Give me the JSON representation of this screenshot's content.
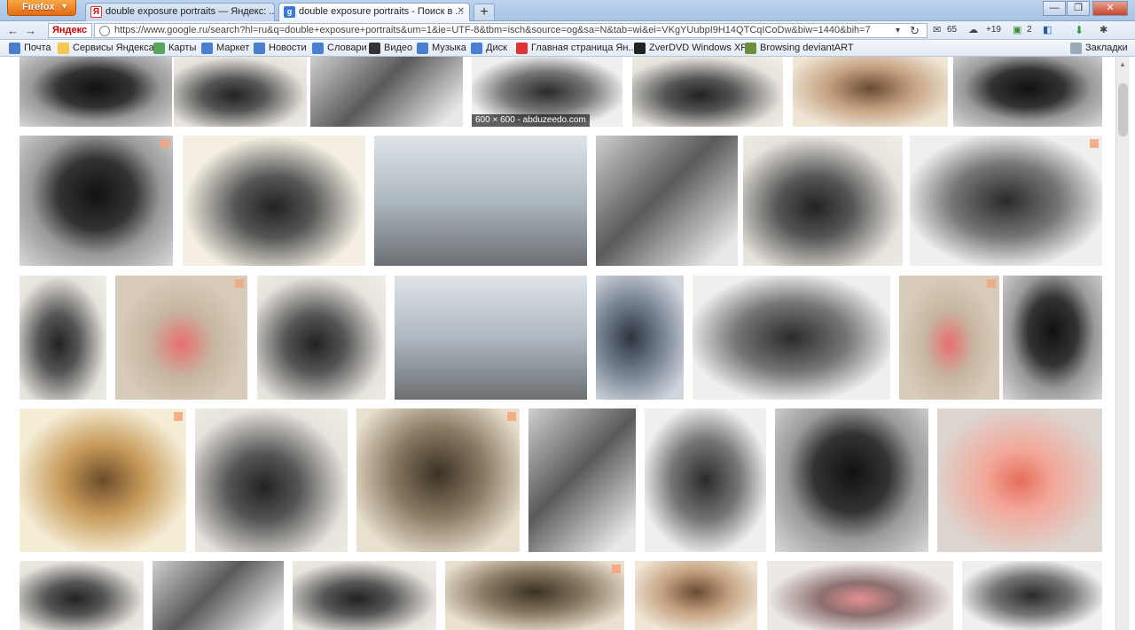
{
  "browser": {
    "app_button": "Firefox",
    "tabs": [
      {
        "title": "double exposure portraits — Яндекс: ...",
        "favicon": "yandex-icon",
        "active": false
      },
      {
        "title": "double exposure portraits - Поиск в ...",
        "favicon": "google-icon",
        "active": true
      }
    ],
    "new_tab": "+",
    "window_controls": {
      "minimize": "—",
      "restore": "❐",
      "close": "✕"
    }
  },
  "navbar": {
    "yandex_label": "Яндекс",
    "url": "https://www.google.ru/search?hl=ru&q=double+exposure+portraits&um=1&ie=UTF-8&tbm=isch&source=og&sa=N&tab=wi&ei=VKgYUubpI9H14QTCqICoDw&biw=1440&bih=7",
    "addons": {
      "mail_count": "65",
      "weather": "+19",
      "tasks_count": "2"
    }
  },
  "bookmarks": {
    "items": [
      {
        "label": "Почта",
        "color": "#4a7fd0"
      },
      {
        "label": "Сервисы Яндекса",
        "color": "#f2c94c"
      },
      {
        "label": "Карты",
        "color": "#58a55c"
      },
      {
        "label": "Маркет",
        "color": "#4a7fd0"
      },
      {
        "label": "Новости",
        "color": "#4a7fd0"
      },
      {
        "label": "Словари",
        "color": "#4a7fd0"
      },
      {
        "label": "Видео",
        "color": "#333333"
      },
      {
        "label": "Музыка",
        "color": "#4a7fd0"
      },
      {
        "label": "Диск",
        "color": "#4a7fd0"
      },
      {
        "label": "Главная страница Ян...",
        "color": "#d33333"
      },
      {
        "label": "ZverDVD Windows XP",
        "color": "#222222"
      },
      {
        "label": "Browsing deviantART",
        "color": "#6a8e3a"
      }
    ],
    "right_label": "Закладки"
  },
  "results": {
    "hover_caption": "600 × 600 - abduzeedo.com"
  }
}
